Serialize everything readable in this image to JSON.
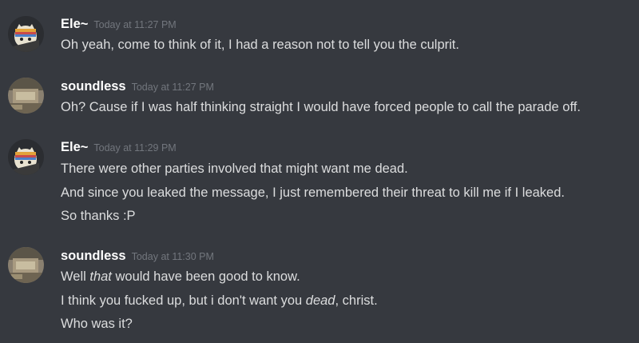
{
  "colors": {
    "background": "#36393f",
    "username": "#ffffff",
    "timestamp": "#72767d",
    "message_text": "#dcddde"
  },
  "messages": [
    {
      "author": "Ele~",
      "avatar": "ele-avatar-icon",
      "timestamp": "Today at 11:27 PM",
      "lines": [
        "Oh yeah, come to think of it, I had a reason not to tell you the culprit."
      ]
    },
    {
      "author": "soundless",
      "avatar": "soundless-avatar-icon",
      "timestamp": "Today at 11:27 PM",
      "lines": [
        "Oh? Cause if I was half thinking straight I would have forced people to call the parade off."
      ]
    },
    {
      "author": "Ele~",
      "avatar": "ele-avatar-icon",
      "timestamp": "Today at 11:29 PM",
      "lines": [
        "There were other parties involved that might want me dead.",
        "And since you leaked the message, I just remembered their threat to kill me if I leaked.",
        "So thanks :P"
      ]
    },
    {
      "author": "soundless",
      "avatar": "soundless-avatar-icon",
      "timestamp": "Today at 11:30 PM",
      "lines_rich": [
        {
          "pre": "Well ",
          "em": "that",
          "post": " would have been good to know."
        },
        {
          "pre": "I think you fucked up, but i don't want you ",
          "em": "dead",
          "post": ", christ."
        },
        {
          "pre": "Who was it?",
          "em": "",
          "post": ""
        }
      ]
    }
  ]
}
